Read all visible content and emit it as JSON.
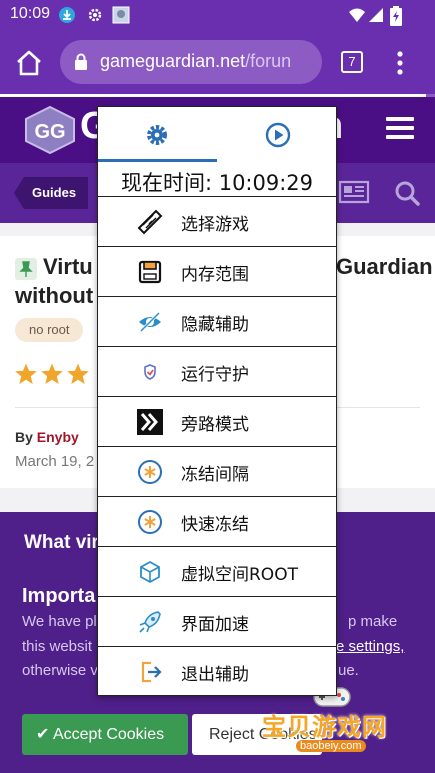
{
  "status_bar": {
    "time": "10:09"
  },
  "browser": {
    "url_host": "gameguardian.net",
    "url_path": "/forun",
    "tab_count": "7",
    "load_progress": 0.98
  },
  "site": {
    "logo_text_left": "G",
    "logo_text_right": "n",
    "nav_guides": "Guides"
  },
  "article": {
    "title_line1_left": "Virtu",
    "title_line1_right": "Guardian",
    "title_line2": "without",
    "tag": "no root",
    "rating_stars": 3,
    "by_label": "By",
    "author": "Enyby",
    "date": "March 19, 2"
  },
  "cookie": {
    "heading": "What vir",
    "important": "Importa",
    "p1_left": "We have pl",
    "p1_right": "p make",
    "p2_left": "this websit",
    "p2_right": "e settings,",
    "p3_left": "otherwise v",
    "p3_right": "ue.",
    "accept_label": "Accept Cookies",
    "reject_label": "Reject Cookies"
  },
  "gg_menu": {
    "time_text": "现在时间: 10:09:29",
    "items": [
      {
        "label": "选择游戏",
        "icon": "game-select-icon"
      },
      {
        "label": "内存范围",
        "icon": "memory-range-icon"
      },
      {
        "label": "隐藏辅助",
        "icon": "hide-eye-icon"
      },
      {
        "label": "运行守护",
        "icon": "shield-icon"
      },
      {
        "label": "旁路模式",
        "icon": "bypass-icon"
      },
      {
        "label": "冻结间隔",
        "icon": "freeze-interval-icon"
      },
      {
        "label": "快速冻结",
        "icon": "quick-freeze-icon"
      },
      {
        "label": "虚拟空间ROOT",
        "icon": "virtual-space-icon"
      },
      {
        "label": "界面加速",
        "icon": "rocket-icon"
      },
      {
        "label": "退出辅助",
        "icon": "exit-icon"
      }
    ]
  },
  "watermark": {
    "text": "宝贝游戏网",
    "sub": "baobeiy.com"
  },
  "colors": {
    "purple": "#6a2fae",
    "dark_purple": "#4b0f85",
    "gg_blue": "#2a6fb5",
    "accept_green": "#3a9a52"
  }
}
